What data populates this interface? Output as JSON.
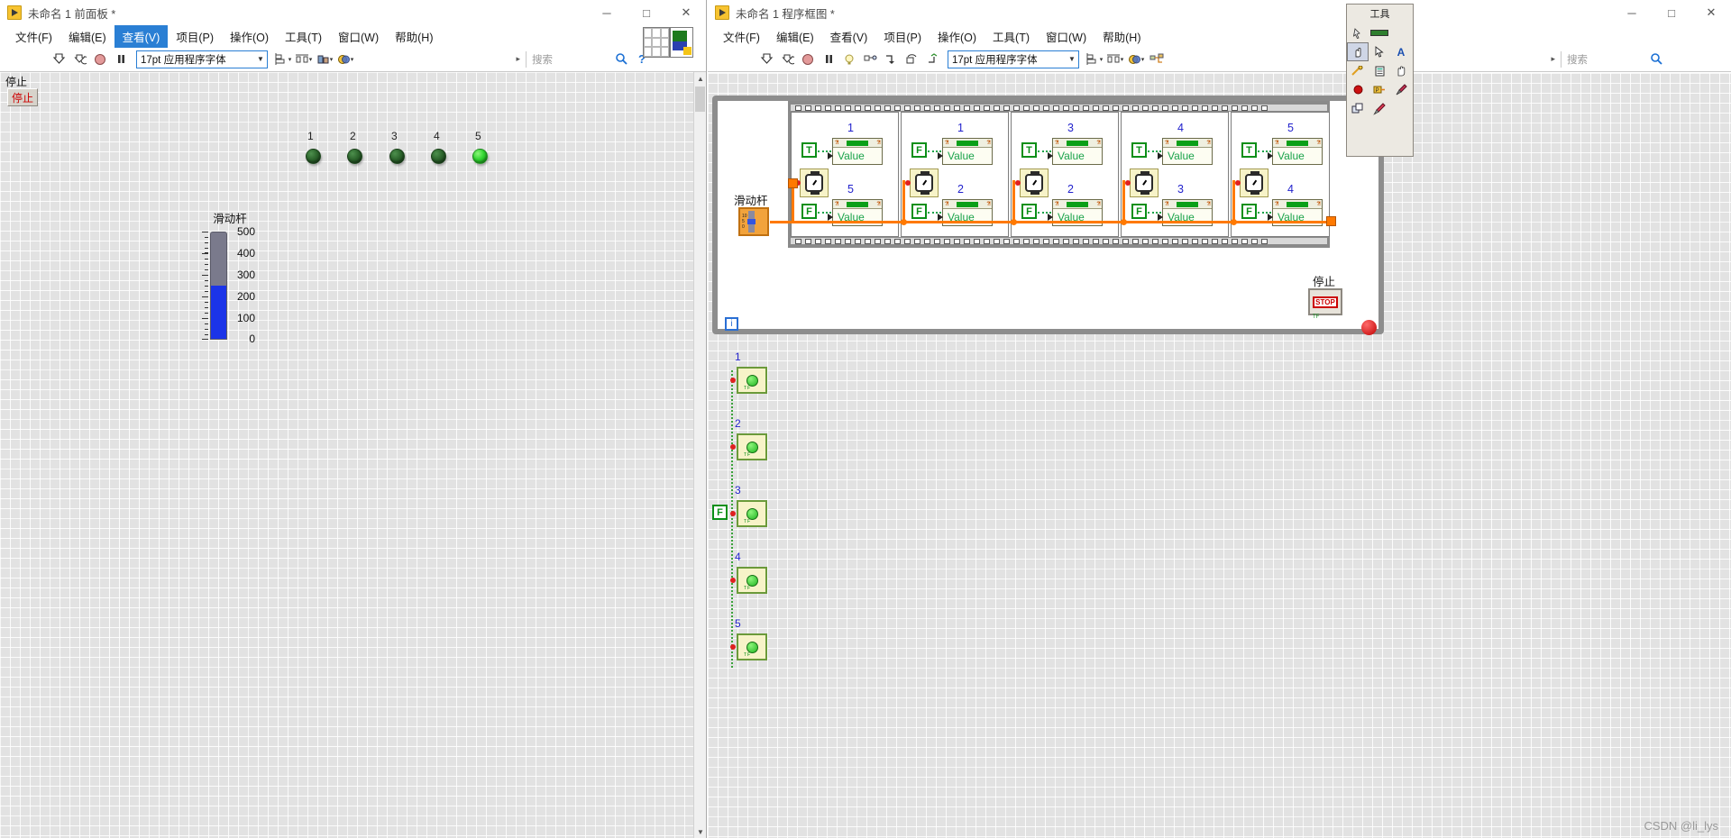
{
  "front_panel": {
    "title": "未命名 1 前面板 *",
    "window_buttons": {
      "minimize": "─",
      "maximize": "□",
      "close": "✕"
    },
    "menu": [
      "文件(F)",
      "编辑(E)",
      "查看(V)",
      "项目(P)",
      "操作(O)",
      "工具(T)",
      "窗口(W)",
      "帮助(H)"
    ],
    "menu_selected": "查看(V)",
    "toolbar": {
      "run": "run-arrow",
      "run_continuous": "run-continuous",
      "abort": "abort",
      "pause": "pause",
      "font": "17pt 应用程序字体",
      "align": "align-objects",
      "distribute": "distribute-objects",
      "resize": "resize-objects",
      "reorder": "reorder-objects",
      "search_placeholder": "搜索",
      "search_icon": "search-icon",
      "help_icon": "help-icon"
    },
    "stop_label": "停止",
    "stop_button": "停止",
    "leds": [
      {
        "label": "1",
        "state": "off"
      },
      {
        "label": "2",
        "state": "off"
      },
      {
        "label": "3",
        "state": "off"
      },
      {
        "label": "4",
        "state": "off"
      },
      {
        "label": "5",
        "state": "on"
      }
    ],
    "slider": {
      "label": "滑动杆",
      "ticks": [
        "500",
        "400",
        "300",
        "200",
        "100",
        "0"
      ],
      "min": 0,
      "max": 500,
      "value": 250
    }
  },
  "block_diagram": {
    "title": "未命名 1 程序框图 *",
    "window_buttons": {
      "minimize": "─",
      "maximize": "□",
      "close": "✕"
    },
    "menu": [
      "文件(F)",
      "编辑(E)",
      "查看(V)",
      "项目(P)",
      "操作(O)",
      "工具(T)",
      "窗口(W)",
      "帮助(H)"
    ],
    "toolbar": {
      "run": "run-arrow",
      "run_continuous": "run-continuous",
      "abort": "abort",
      "pause": "pause",
      "highlight": "highlight-execution",
      "retain_values": "retain-wire-values",
      "step_into": "step-into",
      "step_over": "step-over",
      "step_out": "step-out",
      "font": "17pt 应用程序字体",
      "align": "align-objects",
      "distribute": "distribute-objects",
      "reorder": "reorder-objects",
      "cleanup": "cleanup-diagram",
      "search_placeholder": "搜索",
      "search_icon": "search-icon"
    },
    "slider_terminal_label": "滑动杆",
    "stop_terminal_label": "停止",
    "stop_glyph": "STOP",
    "loop_iteration": "i",
    "frames": [
      {
        "top_num": "1",
        "top_bool": "T",
        "top_prop": "Value",
        "bot_num": "5",
        "bot_bool": "F",
        "bot_prop": "Value"
      },
      {
        "top_num": "1",
        "top_bool": "F",
        "top_prop": "Value",
        "bot_num": "2",
        "bot_bool": "F",
        "bot_prop": "Value"
      },
      {
        "top_num": "3",
        "top_bool": "T",
        "top_prop": "Value",
        "bot_num": "2",
        "bot_bool": "F",
        "bot_prop": "Value"
      },
      {
        "top_num": "4",
        "top_bool": "T",
        "top_prop": "Value",
        "bot_num": "3",
        "bot_bool": "F",
        "bot_prop": "Value"
      },
      {
        "top_num": "5",
        "top_bool": "T",
        "top_prop": "Value",
        "bot_num": "4",
        "bot_bool": "F",
        "bot_prop": "Value"
      }
    ],
    "bottom_terminals": [
      {
        "num": "1"
      },
      {
        "num": "2"
      },
      {
        "num": "3"
      },
      {
        "num": "4"
      },
      {
        "num": "5"
      }
    ],
    "bottom_false_const": "F"
  },
  "tools_palette": {
    "title": "工具",
    "buttons": [
      "operate-value-icon",
      "position-size-icon",
      "edit-text-icon",
      "connect-wire-icon",
      "object-shortcut-icon",
      "scroll-window-icon",
      "set-breakpoint-icon",
      "probe-data-icon",
      "get-color-icon",
      "copy-color-icon",
      "paint-icon"
    ]
  },
  "watermark": "CSDN @li_lys",
  "colors": {
    "accent_blue": "#2a7fd4",
    "wire_orange": "#ff7900",
    "green_value": "#1aa34a",
    "frame_num_blue": "#2222cc",
    "led_on": "#31d531",
    "led_off": "#2d662d",
    "slider_fill": "#1b34e8"
  }
}
